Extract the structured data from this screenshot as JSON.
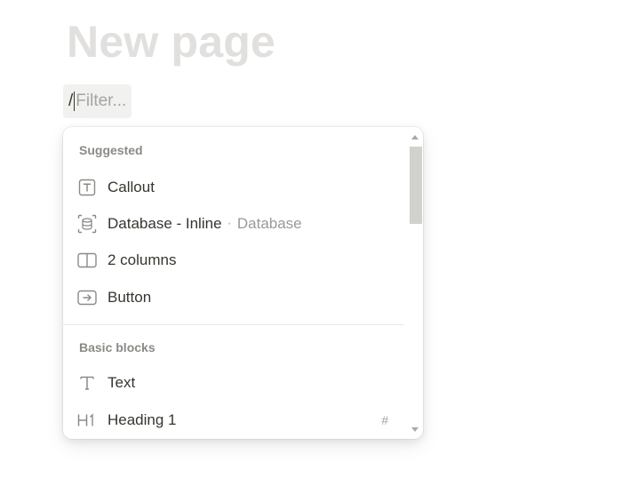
{
  "page": {
    "title": "New page"
  },
  "slash_input": {
    "typed": "/",
    "placeholder": "Filter..."
  },
  "menu": {
    "sections": [
      {
        "heading": "Suggested",
        "items": [
          {
            "label": "Callout",
            "icon": "callout-icon"
          },
          {
            "label": "Database - Inline",
            "sublabel": "Database",
            "separator": "·",
            "icon": "database-icon"
          },
          {
            "label": "2 columns",
            "icon": "columns-icon"
          },
          {
            "label": "Button",
            "icon": "button-icon"
          }
        ]
      },
      {
        "heading": "Basic blocks",
        "items": [
          {
            "label": "Text",
            "icon": "text-icon"
          },
          {
            "label": "Heading 1",
            "icon": "heading1-icon",
            "shortcut": "#"
          }
        ]
      }
    ]
  },
  "colors": {
    "title_placeholder": "#e1e0de",
    "text": "#37352f",
    "muted": "#9b9a97",
    "icon": "#8b8a86",
    "scroll_thumb": "#d3d1cb"
  }
}
